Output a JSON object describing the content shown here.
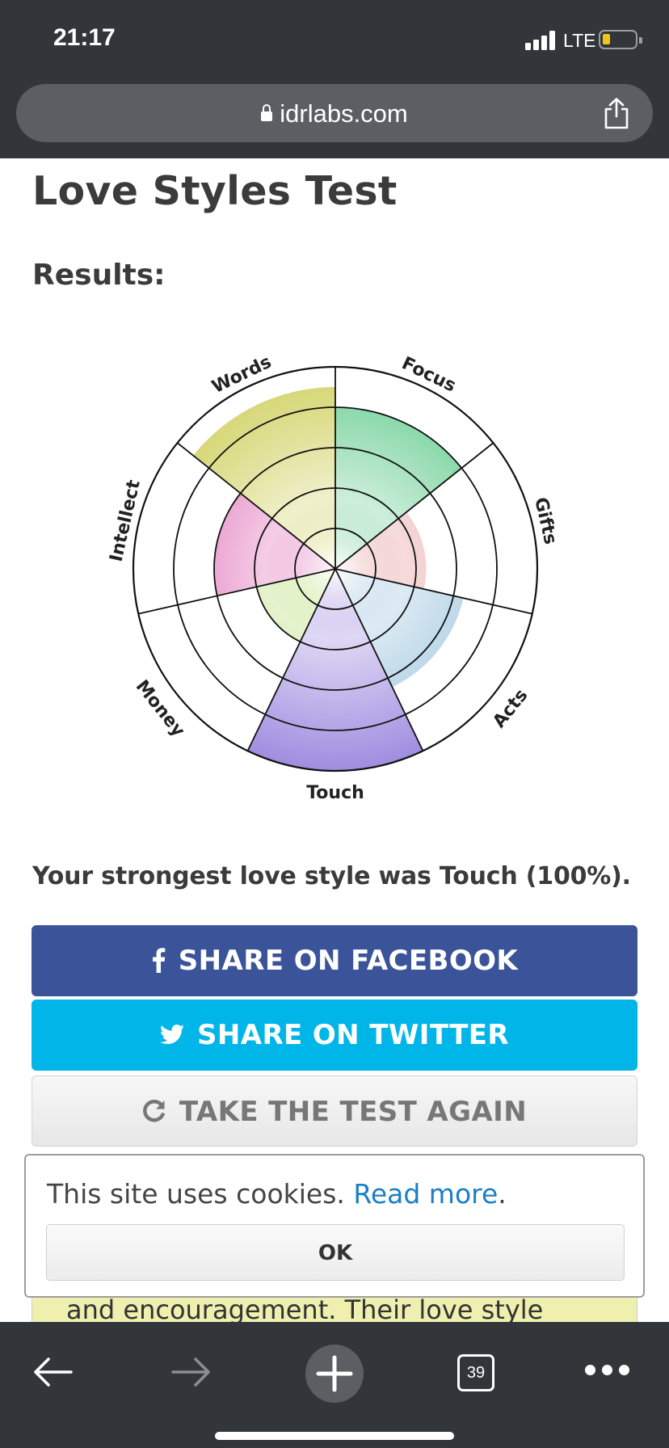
{
  "status_bar": {
    "time": "21:17",
    "network": "LTE"
  },
  "browser": {
    "url": "idrlabs.com",
    "tab_count": "39"
  },
  "page": {
    "title": "Love Styles Test",
    "results_heading": "Results:",
    "summary": "Your strongest love style was Touch (100%).",
    "buttons": {
      "facebook": "SHARE ON FACEBOOK",
      "twitter": "SHARE ON TWITTER",
      "again": "TAKE THE TEST AGAIN"
    },
    "partial_text": "and encouragement. Their love style"
  },
  "cookie_banner": {
    "text": "This site uses cookies. ",
    "link": "Read more",
    "suffix": ".",
    "ok": "OK"
  },
  "chart_data": {
    "type": "polar-area",
    "rings": 5,
    "categories": [
      "Focus",
      "Gifts",
      "Acts",
      "Touch",
      "Money",
      "Intellect",
      "Words"
    ],
    "values": [
      80,
      45,
      65,
      100,
      40,
      60,
      90
    ],
    "colors": [
      "#6fcf97",
      "#e59a9a",
      "#9cc4de",
      "#a08de0",
      "#b6dc72",
      "#df6fb6",
      "#d3d36a"
    ]
  },
  "colors": {
    "facebook": "#3b5499",
    "twitter": "#00b6e8",
    "chrome": "#32363b"
  }
}
